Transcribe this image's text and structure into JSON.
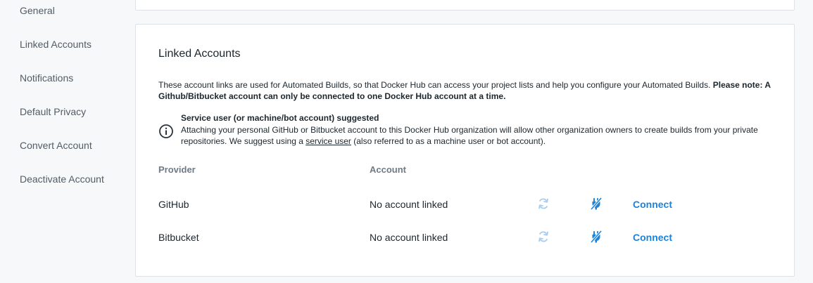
{
  "sidebar": {
    "items": [
      {
        "label": "General"
      },
      {
        "label": "Linked Accounts"
      },
      {
        "label": "Notifications"
      },
      {
        "label": "Default Privacy"
      },
      {
        "label": "Convert Account"
      },
      {
        "label": "Deactivate Account"
      }
    ]
  },
  "linked_accounts": {
    "title": "Linked Accounts",
    "description": "These account links are used for Automated Builds, so that Docker Hub can access your project lists and help you configure your Automated Builds.",
    "description_bold": "Please note: A Github/Bitbucket account can only be connected to one Docker Hub account at a time.",
    "notice": {
      "title": "Service user (or machine/bot account) suggested",
      "body_before": "Attaching your personal GitHub or Bitbucket account to this Docker Hub organization will allow other organization owners to create builds from your private repositories. We suggest using a",
      "link": "service user",
      "body_after": "(also referred to as a machine user or bot account)."
    },
    "columns": {
      "provider": "Provider",
      "account": "Account"
    },
    "rows": [
      {
        "provider": "GitHub",
        "account": "No account linked",
        "action": "Connect"
      },
      {
        "provider": "Bitbucket",
        "account": "No account linked",
        "action": "Connect"
      }
    ]
  },
  "icons": {
    "info": "info-circle-icon",
    "refresh": "refresh-icon",
    "disconnect": "unplug-icon"
  },
  "colors": {
    "accent": "#1d82d8",
    "refresh_icon": "#a9cdef",
    "muted_text": "#6e7a85"
  }
}
